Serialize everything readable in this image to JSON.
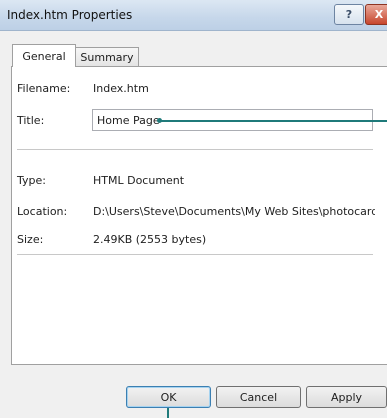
{
  "window": {
    "title": "Index.htm Properties",
    "help_label": "?",
    "close_label": "X"
  },
  "tabs": [
    {
      "label": "General",
      "active": true
    },
    {
      "label": "Summary",
      "active": false
    }
  ],
  "general": {
    "filename_label": "Filename:",
    "filename_value": "Index.htm",
    "title_label": "Title:",
    "title_value": "Home Page",
    "type_label": "Type:",
    "type_value": "HTML Document",
    "location_label": "Location:",
    "location_value": "D:\\Users\\Steve\\Documents\\My Web Sites\\photocards",
    "size_label": "Size:",
    "size_value": "2.49KB (2553 bytes)"
  },
  "buttons": {
    "ok": "OK",
    "cancel": "Cancel",
    "apply": "Apply"
  },
  "colors": {
    "callout": "#1f7a7a",
    "default_button_border": "#3c7fb1"
  }
}
